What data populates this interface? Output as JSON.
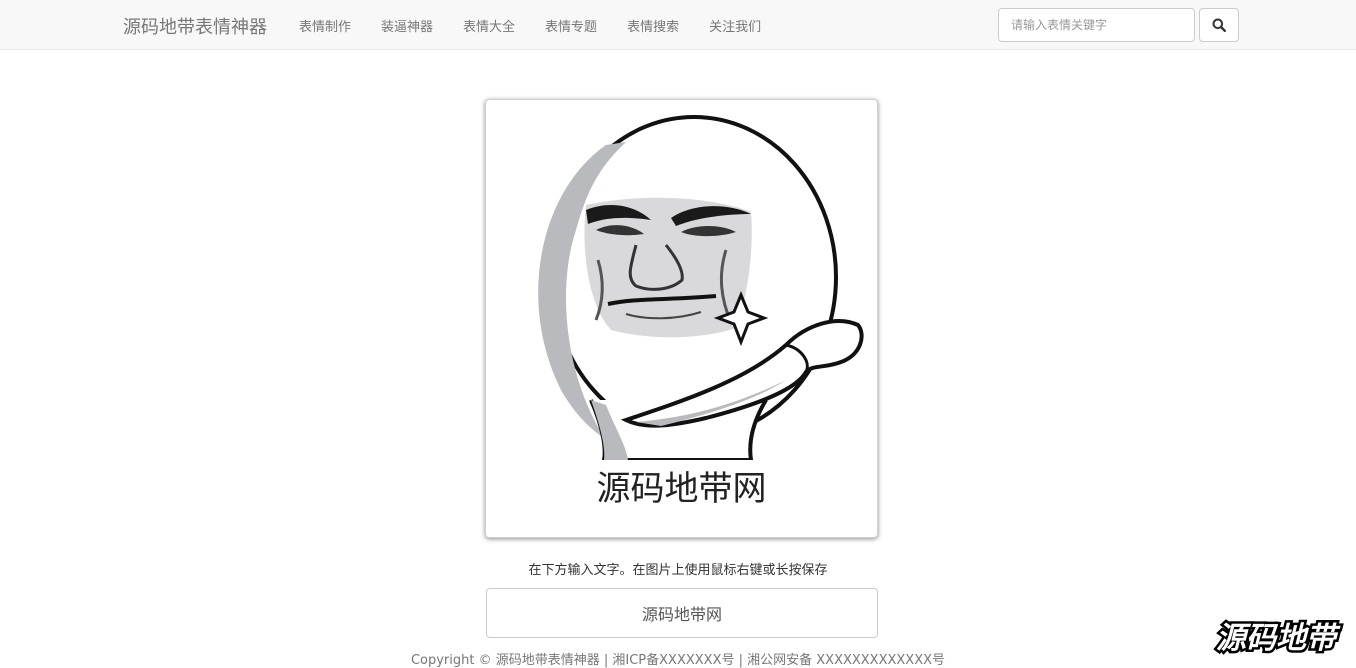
{
  "navbar": {
    "brand": "源码地带表情神器",
    "items": [
      {
        "label": "表情制作"
      },
      {
        "label": "装逼神器"
      },
      {
        "label": "表情大全"
      },
      {
        "label": "表情专题"
      },
      {
        "label": "表情搜索"
      },
      {
        "label": "关注我们"
      }
    ],
    "search": {
      "placeholder": "请输入表情关键字",
      "value": "",
      "icon": "search-icon"
    }
  },
  "meme": {
    "caption": "源码地带网"
  },
  "hint": "在下方输入文字。在图片上使用鼠标右键或长按保存",
  "text_input": {
    "value": "源码地带网"
  },
  "footer": "Copyright © 源码地带表情神器 | 湘ICP备XXXXXXX号 | 湘公网安备 XXXXXXXXXXXXX号",
  "watermark": {
    "text": "源码地带"
  }
}
